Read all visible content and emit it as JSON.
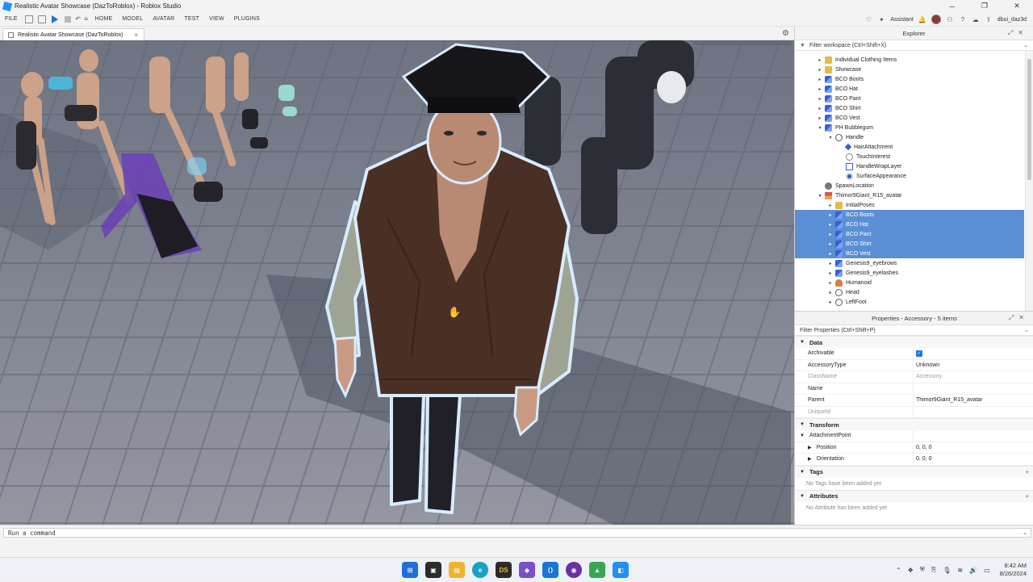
{
  "window": {
    "title": "Realistic Avatar Showcase (DazToRoblox) - Roblox Studio"
  },
  "menu": {
    "file": "FILE",
    "tabs": [
      "HOME",
      "MODEL",
      "AVATAR",
      "TEST",
      "VIEW",
      "PLUGINS"
    ],
    "assistant": "Assistant",
    "username": "dbui_daz3d"
  },
  "document_tab": {
    "label": "Realistic Avatar Showcase (DazToRoblox)",
    "close": "×"
  },
  "explorer": {
    "title": "Explorer",
    "filter_placeholder": "Filter workspace (Ctrl+Shift+X)",
    "items": [
      {
        "label": "Individual Clothing Items",
        "icon": "folder-icon",
        "depth": 1,
        "arrow": "▸",
        "selected": false
      },
      {
        "label": "Showcase",
        "icon": "folder-icon",
        "depth": 1,
        "arrow": "▸",
        "selected": false
      },
      {
        "label": "BCO Boots",
        "icon": "accessory-icon",
        "depth": 1,
        "arrow": "▸",
        "selected": false
      },
      {
        "label": "BCO Hat",
        "icon": "accessory-icon",
        "depth": 1,
        "arrow": "▸",
        "selected": false
      },
      {
        "label": "BCO Pant",
        "icon": "accessory-icon",
        "depth": 1,
        "arrow": "▸",
        "selected": false
      },
      {
        "label": "BCO Shirt",
        "icon": "accessory-icon",
        "depth": 1,
        "arrow": "▸",
        "selected": false
      },
      {
        "label": "BCO Vest",
        "icon": "accessory-icon",
        "depth": 1,
        "arrow": "▸",
        "selected": false
      },
      {
        "label": "PH Bubblegum",
        "icon": "accessory-icon",
        "depth": 1,
        "arrow": "▾",
        "selected": false
      },
      {
        "label": "Handle",
        "icon": "part-icon",
        "depth": 2,
        "arrow": "▾",
        "selected": false
      },
      {
        "label": "HairAttachment",
        "icon": "attachment-icon",
        "depth": 3,
        "arrow": "",
        "selected": false
      },
      {
        "label": "TouchInterest",
        "icon": "touch-icon",
        "depth": 3,
        "arrow": "",
        "selected": false
      },
      {
        "label": "HandleWrapLayer",
        "icon": "wraplayer-icon",
        "depth": 3,
        "arrow": "",
        "selected": false
      },
      {
        "label": "SurfaceAppearance",
        "icon": "surface-icon",
        "depth": 3,
        "arrow": "",
        "selected": false
      },
      {
        "label": "SpawnLocation",
        "icon": "spawn-icon",
        "depth": 1,
        "arrow": "",
        "selected": false
      },
      {
        "label": "Thimor9Giant_R15_avatar",
        "icon": "model-icon",
        "depth": 1,
        "arrow": "▾",
        "selected": false
      },
      {
        "label": "InitialPoses",
        "icon": "folder-icon",
        "depth": 2,
        "arrow": "▸",
        "selected": false
      },
      {
        "label": "BCO Boots",
        "icon": "accessory-icon",
        "depth": 2,
        "arrow": "▸",
        "selected": true
      },
      {
        "label": "BCO Hat",
        "icon": "accessory-icon",
        "depth": 2,
        "arrow": "▸",
        "selected": true
      },
      {
        "label": "BCO Pant",
        "icon": "accessory-icon",
        "depth": 2,
        "arrow": "▸",
        "selected": true
      },
      {
        "label": "BCO Shirt",
        "icon": "accessory-icon",
        "depth": 2,
        "arrow": "▸",
        "selected": true
      },
      {
        "label": "BCO Vest",
        "icon": "accessory-icon",
        "depth": 2,
        "arrow": "▸",
        "selected": true
      },
      {
        "label": "Genesis9_eyebrows",
        "icon": "accessory-icon",
        "depth": 2,
        "arrow": "▸",
        "selected": false
      },
      {
        "label": "Genesis9_eyelashes",
        "icon": "accessory-icon",
        "depth": 2,
        "arrow": "▸",
        "selected": false
      },
      {
        "label": "Humanoid",
        "icon": "humanoid-icon",
        "depth": 2,
        "arrow": "▸",
        "selected": false
      },
      {
        "label": "Head",
        "icon": "part-icon",
        "depth": 2,
        "arrow": "▸",
        "selected": false
      },
      {
        "label": "LeftFoot",
        "icon": "part-icon",
        "depth": 2,
        "arrow": "▸",
        "selected": false
      }
    ]
  },
  "properties": {
    "title": "Properties - Accessory - 5 items",
    "filter_placeholder": "Filter Properties (Ctrl+Shift+P)",
    "sections": {
      "data": "Data",
      "transform": "Transform",
      "tags": "Tags",
      "attributes": "Attributes"
    },
    "rows": {
      "archivable": {
        "name": "Archivable",
        "checked": true
      },
      "accessory_type": {
        "name": "AccessoryType",
        "value": "Unknown"
      },
      "class_name": {
        "name": "ClassName",
        "value": "Accessory"
      },
      "name": {
        "name": "Name",
        "value": ""
      },
      "parent": {
        "name": "Parent",
        "value": "Thimor9Giant_R15_avatar"
      },
      "unique_id": {
        "name": "UniqueId",
        "value": ""
      },
      "attachment_point": {
        "name": "AttachmentPoint",
        "value": ""
      },
      "position": {
        "name": "Position",
        "value": "0, 0, 0"
      },
      "orientation": {
        "name": "Orientation",
        "value": "0, 0, 0"
      }
    },
    "tags_empty": "No Tags have been added yet",
    "attributes_empty": "No Attribute has been added yet"
  },
  "command_bar": {
    "placeholder": "Run a command"
  },
  "taskbar": {
    "time": "8:42 AM",
    "date": "8/26/2024"
  },
  "colors": {
    "selection": "#5a8fd6",
    "accent": "#1e78d7",
    "outline": "#cfe6ff"
  }
}
